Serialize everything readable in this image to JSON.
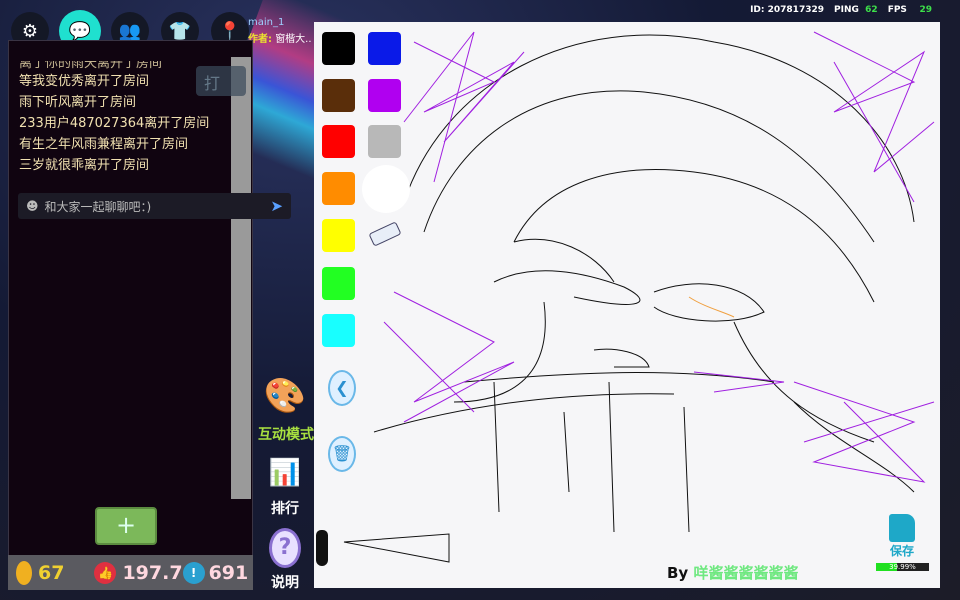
{
  "header": {
    "room": "main_1",
    "author_label": "作者:",
    "author_name": "窗楷大..",
    "id": "ID: 207817329",
    "ping_label": "PING",
    "ping": "62",
    "fps_label": "FPS",
    "fps": "29"
  },
  "chat": {
    "messages": [
      "离了你的雨天离开了房间",
      "等我变优秀离开了房间",
      "雨下听风离开了房间",
      "233用户487027364离开了房间",
      "有生之年风雨兼程离开了房间",
      "三岁就很乖离开了房间"
    ],
    "ghost_button": "打",
    "placeholder": "和大家一起聊聊吧：)",
    "add_button": "+"
  },
  "stats": {
    "coins": "67",
    "likes": "197.7",
    "reports": "691"
  },
  "side": {
    "interactive": "互动模式",
    "ranking": "排行",
    "help": "说明"
  },
  "palette": {
    "colors": [
      "#000000",
      "#0a1ae8",
      "#5a2e0a",
      "#b000f0",
      "#ff0000",
      "#b8b8b8",
      "#ff8c00",
      "#ffffff",
      "#ffff00",
      "#22ff22",
      "#18ffff"
    ]
  },
  "canvas": {
    "by_label": "By",
    "artist": "咩酱酱酱酱酱酱",
    "save_label": "保存",
    "progress_text": "39.99%",
    "progress": 39.99
  },
  "colors": {
    "accent": "#1fe0cf",
    "stroke_purple": "#a020e0"
  }
}
